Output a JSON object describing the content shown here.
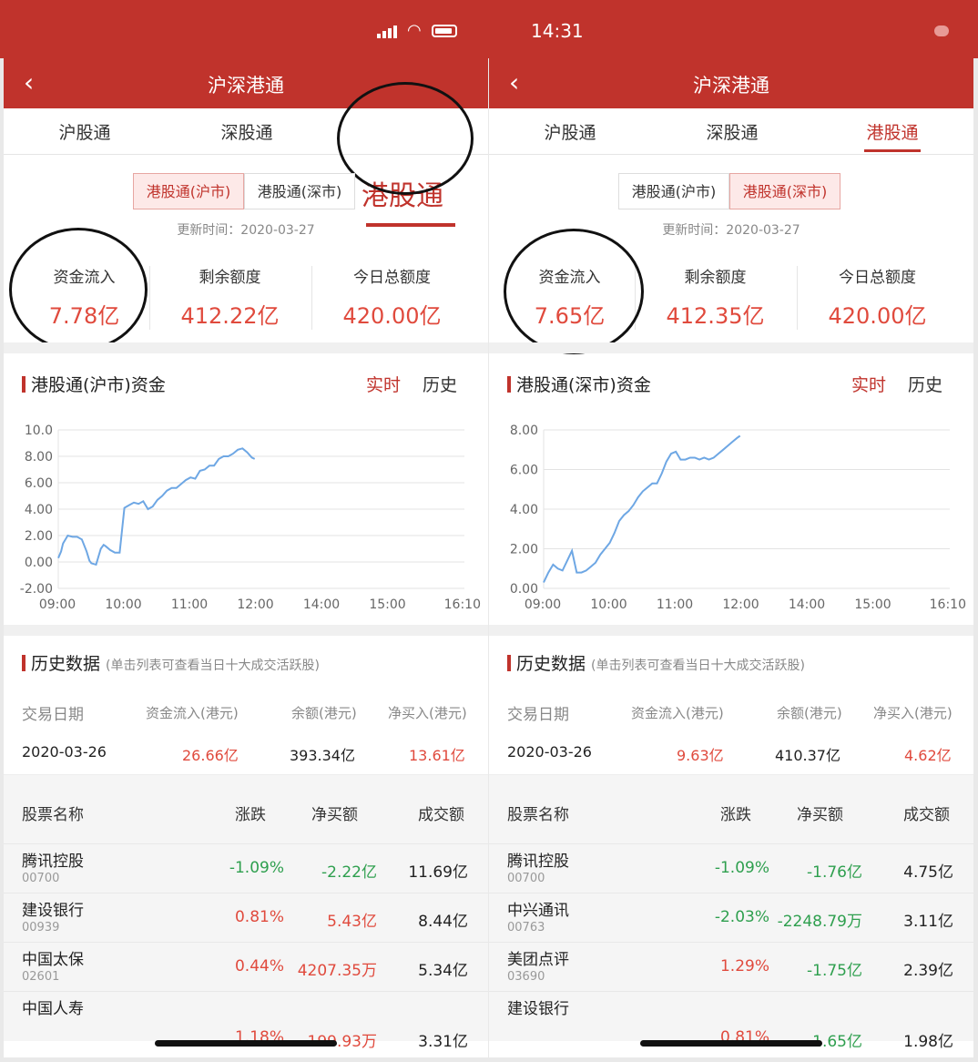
{
  "status_bar": {
    "time": "14:31"
  },
  "colors": {
    "brand": "#c0332c",
    "up": "#e04a3d",
    "down": "#2e9f4e",
    "line": "#6ea7e4"
  },
  "panels": [
    {
      "nav_title": "沪深港通",
      "tabs": [
        "沪股通",
        "深股通",
        "港股通"
      ],
      "active_tab": "港股通",
      "segments": [
        "港股通(沪市)",
        "港股通(深市)"
      ],
      "active_segment": "港股通(沪市)",
      "update_time": "更新时间：2020-03-27",
      "stats": [
        {
          "label": "资金流入",
          "value": "7.78亿"
        },
        {
          "label": "剩余额度",
          "value": "412.22亿"
        },
        {
          "label": "今日总额度",
          "value": "420.00亿"
        }
      ],
      "chart_section": {
        "title": "港股通(沪市)资金",
        "realtime": "实时",
        "history": "历史"
      },
      "history_section": {
        "title": "历史数据",
        "hint": "(单击列表可查看当日十大成交活跃股)"
      },
      "history_headers": [
        "交易日期",
        "资金流入(港元)",
        "余额(港元)",
        "净买入(港元)"
      ],
      "history_row": {
        "date": "2020-03-26",
        "inflow": "26.66亿",
        "balance": "393.34亿",
        "net_buy": "13.61亿"
      },
      "stock_headers": [
        "股票名称",
        "涨跌",
        "净买额",
        "成交额"
      ],
      "stocks": [
        {
          "name": "腾讯控股",
          "code": "00700",
          "change": "-1.09%",
          "net": "-2.22亿",
          "turnover": "11.69亿"
        },
        {
          "name": "建设银行",
          "code": "00939",
          "change": "0.81%",
          "net": "5.43亿",
          "turnover": "8.44亿"
        },
        {
          "name": "中国太保",
          "code": "02601",
          "change": "0.44%",
          "net": "4207.35万",
          "turnover": "5.34亿"
        },
        {
          "name": "中国人寿",
          "code": "",
          "change": "1.18%",
          "net": "199.93万",
          "turnover": "3.31亿"
        }
      ]
    },
    {
      "nav_title": "沪深港通",
      "tabs": [
        "沪股通",
        "深股通",
        "港股通"
      ],
      "active_tab": "港股通",
      "segments": [
        "港股通(沪市)",
        "港股通(深市)"
      ],
      "active_segment": "港股通(深市)",
      "update_time": "更新时间：2020-03-27",
      "stats": [
        {
          "label": "资金流入",
          "value": "7.65亿"
        },
        {
          "label": "剩余额度",
          "value": "412.35亿"
        },
        {
          "label": "今日总额度",
          "value": "420.00亿"
        }
      ],
      "chart_section": {
        "title": "港股通(深市)资金",
        "realtime": "实时",
        "history": "历史"
      },
      "history_section": {
        "title": "历史数据",
        "hint": "(单击列表可查看当日十大成交活跃股)"
      },
      "history_headers": [
        "交易日期",
        "资金流入(港元)",
        "余额(港元)",
        "净买入(港元)"
      ],
      "history_row": {
        "date": "2020-03-26",
        "inflow": "9.63亿",
        "balance": "410.37亿",
        "net_buy": "4.62亿"
      },
      "stock_headers": [
        "股票名称",
        "涨跌",
        "净买额",
        "成交额"
      ],
      "stocks": [
        {
          "name": "腾讯控股",
          "code": "00700",
          "change": "-1.09%",
          "net": "-1.76亿",
          "turnover": "4.75亿"
        },
        {
          "name": "中兴通讯",
          "code": "00763",
          "change": "-2.03%",
          "net": "-2248.79万",
          "turnover": "3.11亿"
        },
        {
          "name": "美团点评",
          "code": "03690",
          "change": "1.29%",
          "net": "-1.75亿",
          "turnover": "2.39亿"
        },
        {
          "name": "建设银行",
          "code": "",
          "change": "0.81%",
          "net": "1.65亿",
          "turnover": "1.98亿"
        }
      ]
    }
  ],
  "chart_data": [
    {
      "type": "line",
      "title": "",
      "x_ticks": [
        "09:00",
        "10:00",
        "11:00",
        "12:00",
        "14:00",
        "15:00",
        "16:10"
      ],
      "y_ticks": [
        "10.0",
        "8.00",
        "6.00",
        "4.00",
        "2.00",
        "0.00",
        "-2.00"
      ],
      "ylim": [
        -2,
        10
      ],
      "grid": true,
      "series": [
        {
          "x": [
            0,
            3,
            5,
            10,
            15,
            20,
            25,
            30,
            33,
            35,
            40,
            45,
            48,
            50,
            55,
            60,
            65,
            70,
            75,
            80,
            85,
            90,
            95,
            100,
            105,
            110,
            115,
            120,
            125,
            130,
            135,
            140,
            145,
            150,
            155,
            160,
            165,
            170,
            175,
            180,
            185,
            190,
            195,
            200,
            205,
            208
          ],
          "y": [
            0.3,
            0.8,
            1.4,
            2.0,
            1.9,
            1.9,
            1.7,
            0.8,
            0.1,
            -0.1,
            -0.2,
            1.0,
            1.3,
            1.2,
            0.9,
            0.7,
            0.7,
            4.1,
            4.3,
            4.5,
            4.4,
            4.6,
            4.0,
            4.2,
            4.7,
            5.0,
            5.4,
            5.6,
            5.6,
            5.9,
            6.2,
            6.4,
            6.3,
            6.9,
            7.0,
            7.3,
            7.3,
            7.8,
            8.0,
            8.0,
            8.2,
            8.5,
            8.6,
            8.3,
            7.9,
            7.8
          ]
        }
      ]
    },
    {
      "type": "line",
      "title": "",
      "x_ticks": [
        "09:00",
        "10:00",
        "11:00",
        "12:00",
        "14:00",
        "15:00",
        "16:10"
      ],
      "y_ticks": [
        "8.00",
        "6.00",
        "4.00",
        "2.00",
        "0.00"
      ],
      "ylim": [
        0,
        8
      ],
      "grid": true,
      "series": [
        {
          "x": [
            0,
            5,
            10,
            15,
            20,
            25,
            30,
            35,
            40,
            45,
            50,
            55,
            60,
            65,
            70,
            75,
            80,
            85,
            90,
            95,
            100,
            105,
            110,
            115,
            120,
            125,
            130,
            135,
            140,
            145,
            150,
            155,
            160,
            165,
            170,
            175,
            180,
            185,
            190,
            195,
            200,
            205,
            208
          ],
          "y": [
            0.3,
            0.8,
            1.2,
            1.0,
            0.9,
            1.4,
            1.9,
            0.8,
            0.8,
            0.9,
            1.1,
            1.3,
            1.7,
            2.0,
            2.3,
            2.8,
            3.4,
            3.7,
            3.9,
            4.2,
            4.6,
            4.9,
            5.1,
            5.3,
            5.3,
            5.8,
            6.4,
            6.8,
            6.9,
            6.5,
            6.5,
            6.6,
            6.6,
            6.5,
            6.6,
            6.5,
            6.6,
            6.8,
            7.0,
            7.2,
            7.4,
            7.6,
            7.7
          ]
        }
      ]
    }
  ]
}
